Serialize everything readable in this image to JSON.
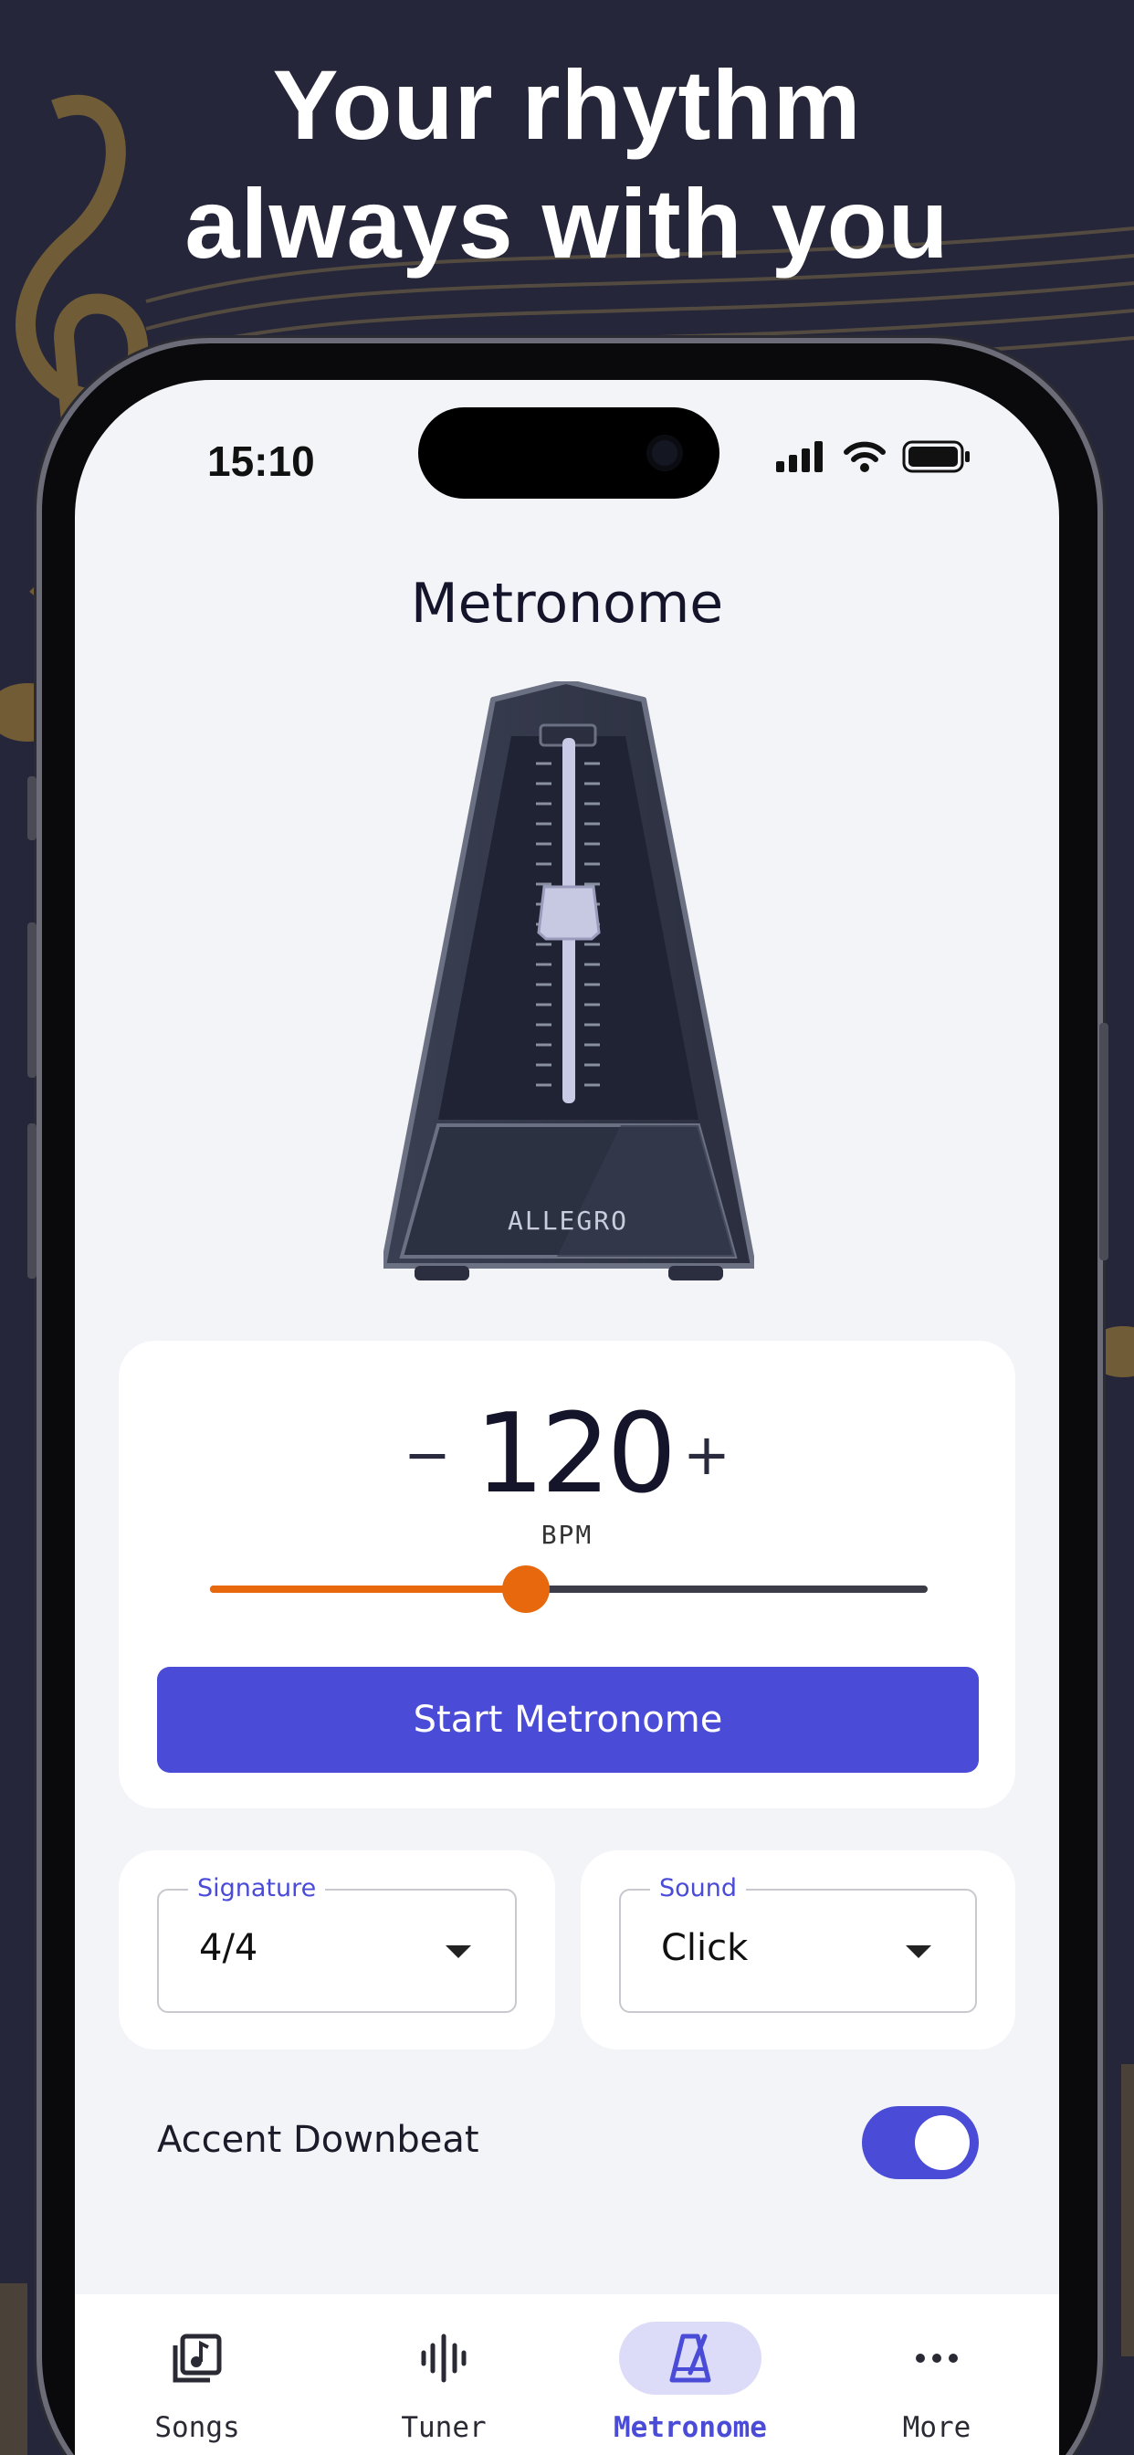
{
  "headline": {
    "line1": "Your rhythm",
    "line2": "always with you"
  },
  "status_bar": {
    "time": "15:10",
    "icons": [
      "signal-icon",
      "wifi-icon",
      "battery-icon"
    ]
  },
  "app": {
    "title": "Metronome",
    "illustration_label": "ALLEGRO",
    "bpm": {
      "minus_label": "−",
      "value": "120",
      "plus_label": "+",
      "unit": "BPM",
      "slider_fraction": 0.44
    },
    "start_button_label": "Start Metronome",
    "signature": {
      "legend": "Signature",
      "value": "4/4"
    },
    "sound": {
      "legend": "Sound",
      "value": "Click"
    },
    "accent": {
      "label": "Accent Downbeat",
      "enabled": true
    }
  },
  "tabs": [
    {
      "label": "Songs",
      "icon": "music-library-icon",
      "active": false
    },
    {
      "label": "Tuner",
      "icon": "waveform-icon",
      "active": false
    },
    {
      "label": "Metronome",
      "icon": "metronome-icon",
      "active": true
    },
    {
      "label": "More",
      "icon": "more-dots-icon",
      "active": false
    }
  ],
  "colors": {
    "background": "#26263a",
    "accent": "#4a4bd7",
    "slider": "#e8690d",
    "music_decoration": "#8a6f35"
  }
}
